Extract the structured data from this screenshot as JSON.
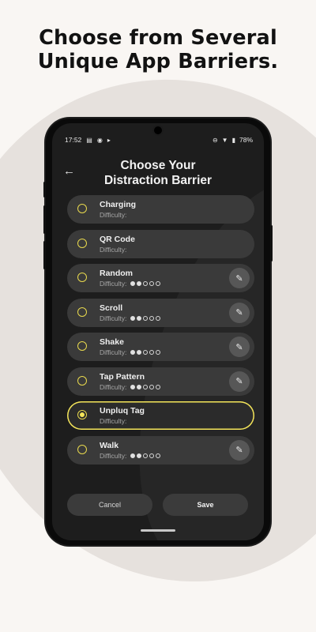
{
  "headline": {
    "line1": "Choose from Several",
    "line2": "Unique App Barriers."
  },
  "statusbar": {
    "time": "17:52",
    "battery": "78%"
  },
  "screen": {
    "title_line1": "Choose Your",
    "title_line2": "Distraction Barrier"
  },
  "options": [
    {
      "label": "Charging",
      "difficulty_label": "Difficulty:",
      "difficulty": null,
      "selected": false,
      "editable": false
    },
    {
      "label": "QR Code",
      "difficulty_label": "Difficulty:",
      "difficulty": null,
      "selected": false,
      "editable": false
    },
    {
      "label": "Random",
      "difficulty_label": "Difficulty:",
      "difficulty": 2,
      "selected": false,
      "editable": true
    },
    {
      "label": "Scroll",
      "difficulty_label": "Difficulty:",
      "difficulty": 2,
      "selected": false,
      "editable": true
    },
    {
      "label": "Shake",
      "difficulty_label": "Difficulty:",
      "difficulty": 2,
      "selected": false,
      "editable": true
    },
    {
      "label": "Tap Pattern",
      "difficulty_label": "Difficulty:",
      "difficulty": 2,
      "selected": false,
      "editable": true
    },
    {
      "label": "Unpluq Tag",
      "difficulty_label": "Difficulty:",
      "difficulty": null,
      "selected": true,
      "editable": false
    },
    {
      "label": "Walk",
      "difficulty_label": "Difficulty:",
      "difficulty": 2,
      "selected": false,
      "editable": true
    }
  ],
  "difficulty_max": 5,
  "buttons": {
    "cancel": "Cancel",
    "save": "Save"
  },
  "colors": {
    "accent": "#f4e55a",
    "screen_bg": "#1d1d1d",
    "option_bg": "#3a3a3a"
  }
}
